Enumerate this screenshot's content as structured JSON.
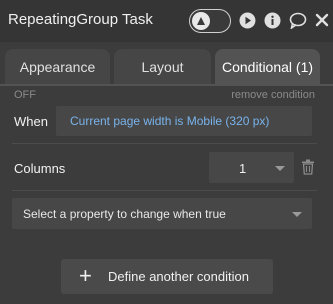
{
  "header": {
    "title": "RepeatingGroup Task",
    "icons": [
      "preview-toggle-icon",
      "play-icon",
      "info-icon",
      "comment-icon",
      "close-icon"
    ]
  },
  "tabs": [
    {
      "label": "Appearance",
      "active": false
    },
    {
      "label": "Layout",
      "active": false
    },
    {
      "label": "Conditional (1)",
      "active": true
    }
  ],
  "condition": {
    "status": "OFF",
    "remove_label": "remove condition",
    "when_label": "When",
    "when_expression": "Current page width is Mobile (320 px)",
    "property_label": "Columns",
    "property_value": "1",
    "property_select_placeholder": "Select a property to change when true"
  },
  "actions": {
    "define_label": "Define another condition",
    "define_icon": "+"
  },
  "colors": {
    "background": "#3c3c3c",
    "header": "#353535",
    "active_tab": "#535353",
    "expression_text": "#79b3ec"
  }
}
